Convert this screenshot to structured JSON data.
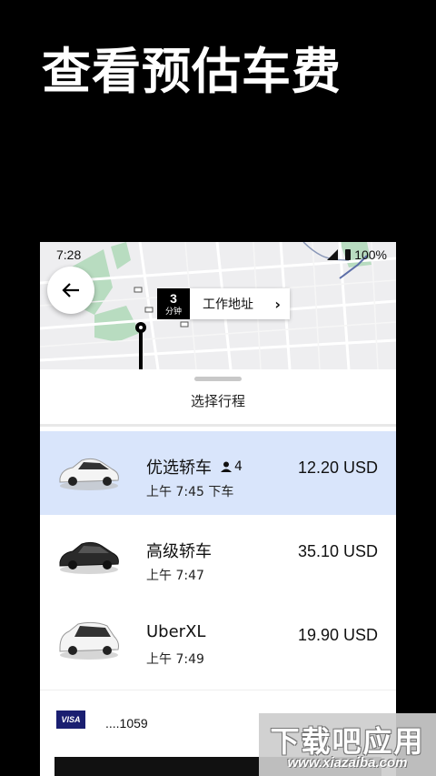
{
  "headline": "查看预估车费",
  "status_bar": {
    "time": "7:28",
    "battery": "100%"
  },
  "map": {
    "eta_minutes": "3",
    "eta_unit": "分钟",
    "destination": "工作地址",
    "destination_chevron": "›"
  },
  "sheet": {
    "title": "选择行程"
  },
  "rides": [
    {
      "name": "优选轿车",
      "seats": "4",
      "time": "上午 7:45 下车",
      "price": "12.20 USD",
      "selected": true,
      "car_color": "white"
    },
    {
      "name": "高级轿车",
      "seats": "",
      "time": "上午 7:47",
      "price": "35.10 USD",
      "selected": false,
      "car_color": "black"
    },
    {
      "name": "UberXL",
      "seats": "",
      "time": "上午 7:49",
      "price": "19.90 USD",
      "selected": false,
      "car_color": "white"
    }
  ],
  "payment": {
    "card_brand": "VISA",
    "card_number": "....1059"
  },
  "watermark": {
    "title": "下载吧应用",
    "url": "www.xiazaiba.com"
  },
  "colors": {
    "selected_bg": "#d9e5fb",
    "background": "#000000",
    "map_green": "#b8dcc0"
  }
}
